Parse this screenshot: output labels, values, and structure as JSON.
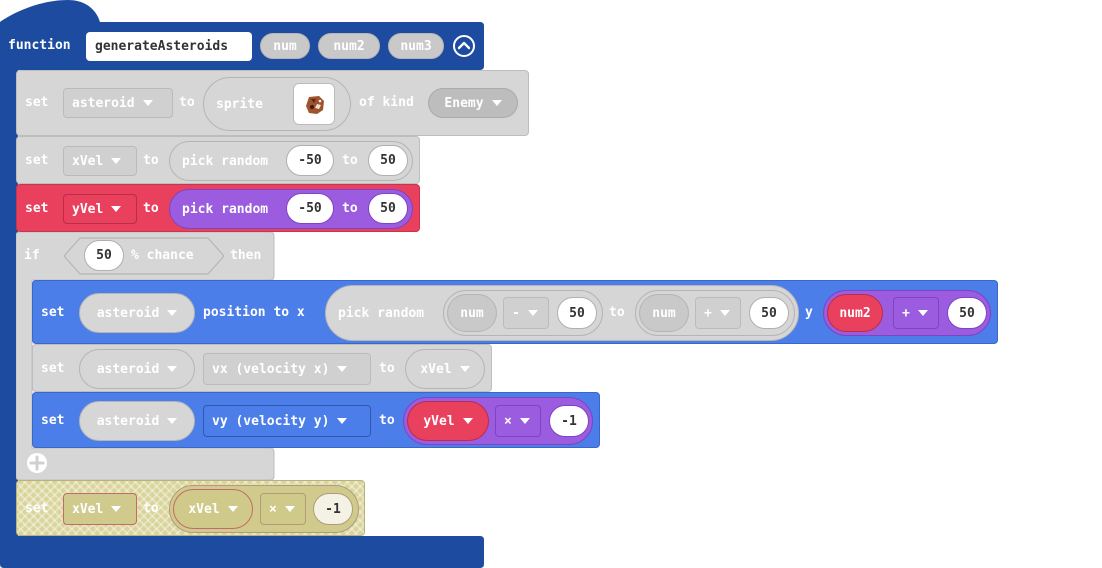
{
  "function_block": {
    "keyword": "function",
    "name": "generateAsteroids",
    "params": [
      "num",
      "num2",
      "num3"
    ],
    "collapse_icon": "chevron-up-circle-icon"
  },
  "stmt1": {
    "set": "set",
    "var": "asteroid",
    "to": "to",
    "sprite": "sprite",
    "of_kind": "of kind",
    "kind": "Enemy",
    "sprite_icon": "asteroid-sprite-image"
  },
  "stmt2": {
    "set": "set",
    "var": "xVel",
    "to": "to",
    "fn": "pick random",
    "min": "-50",
    "to2": "to",
    "max": "50"
  },
  "stmt3": {
    "set": "set",
    "var": "yVel",
    "to": "to",
    "fn": "pick random",
    "min": "-50",
    "to2": "to",
    "max": "50"
  },
  "if_block": {
    "if": "if",
    "chance_value": "50",
    "chance_label": "% chance",
    "then": "then",
    "add_icon": "plus-circle-icon"
  },
  "pos_stmt": {
    "set": "set",
    "sprite": "asteroid",
    "prop": "position to x",
    "fn": "pick random",
    "a_var": "num",
    "a_op": "-",
    "a_val": "50",
    "to": "to",
    "b_var": "num",
    "b_op": "+",
    "b_val": "50",
    "y": "y",
    "c_var": "num2",
    "c_op": "+",
    "c_val": "50"
  },
  "vx_stmt": {
    "set": "set",
    "sprite": "asteroid",
    "prop": "vx (velocity x)",
    "to": "to",
    "var": "xVel"
  },
  "vy_stmt": {
    "set": "set",
    "sprite": "asteroid",
    "prop": "vy (velocity y)",
    "to": "to",
    "var": "yVel",
    "op": "×",
    "val": "-1"
  },
  "last_stmt": {
    "set": "set",
    "var": "xVel",
    "to": "to",
    "var2": "xVel",
    "op": "×",
    "val": "-1"
  },
  "colors": {
    "function_blue": "#1c4ba0",
    "disabled_gray": "#d6d6d6",
    "variables_red": "#e8405d",
    "math_purple": "#9b5ce0",
    "sprites_blue": "#4c7ee9",
    "hatched_olive": "#cdc88a"
  }
}
